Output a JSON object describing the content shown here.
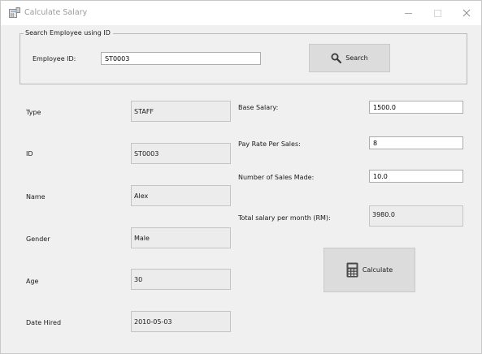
{
  "window": {
    "title": "Calculate Salary",
    "app_icon": "calculator-app-icon",
    "controls": [
      "minimize-icon",
      "maximize-icon",
      "close-icon"
    ]
  },
  "search": {
    "group_label": "Search Employee using ID",
    "employee_id_label": "Employee ID:",
    "employee_id_value": "ST0003",
    "button_label": "Search",
    "button_icon": "search-icon"
  },
  "employee": {
    "type_label": "Type",
    "type_value": "STAFF",
    "id_label": "ID",
    "id_value": "ST0003",
    "name_label": "Name",
    "name_value": "Alex",
    "gender_label": "Gender",
    "gender_value": "Male",
    "age_label": "Age",
    "age_value": "30",
    "date_hired_label": "Date Hired",
    "date_hired_value": "2010-05-03"
  },
  "salary": {
    "base_label": "Base Salary:",
    "base_value": "1500.0",
    "pay_rate_label": "Pay Rate Per Sales:",
    "pay_rate_value": "8",
    "sales_made_label": "Number of Sales Made:",
    "sales_made_value": "10.0",
    "total_label": "Total salary per month (RM):",
    "total_value": "3980.0",
    "calculate_label": "Calculate",
    "calculate_icon": "calculator-icon"
  },
  "colors": {
    "window_bg": "#f0f0f0",
    "titlebar_bg": "#ffffff",
    "button_bg": "#dcdcdc",
    "readonly_bg": "#ececec"
  }
}
